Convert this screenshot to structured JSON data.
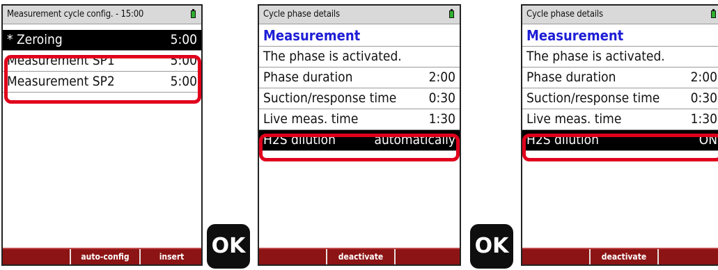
{
  "screen1": {
    "title": "Measurement cycle config. - 15:00",
    "rows": [
      {
        "label": "* Zeroing",
        "value": "5:00"
      },
      {
        "label": "Measurement SP1",
        "value": "5:00"
      },
      {
        "label": "Measurement SP2",
        "value": "5:00"
      }
    ],
    "footer": {
      "btn1": "auto-config",
      "btn2": "insert"
    }
  },
  "ok_label": "OK",
  "screen2": {
    "title": "Cycle phase details",
    "heading": "Measurement",
    "status": "The phase is activated.",
    "rows": [
      {
        "label": "Phase duration",
        "value": "2:00"
      },
      {
        "label": "Suction/response time",
        "value": "0:30"
      },
      {
        "label": "Live meas. time",
        "value": "1:30"
      },
      {
        "label": "H2S dilution",
        "value": "automatically"
      }
    ],
    "footer": {
      "btn1": "deactivate"
    }
  },
  "screen3": {
    "title": "Cycle phase details",
    "heading": "Measurement",
    "status": "The phase is activated.",
    "rows": [
      {
        "label": "Phase duration",
        "value": "2:00"
      },
      {
        "label": "Suction/response time",
        "value": "0:30"
      },
      {
        "label": "Live meas. time",
        "value": "1:30"
      },
      {
        "label": "H2S dilution",
        "value": "ON"
      }
    ],
    "footer": {
      "btn1": "deactivate"
    }
  },
  "colors": {
    "accent_red": "#e0001c",
    "footer_bg": "#8c1414",
    "heading_blue": "#1e1ed6",
    "battery_green": "#2fae2f"
  }
}
